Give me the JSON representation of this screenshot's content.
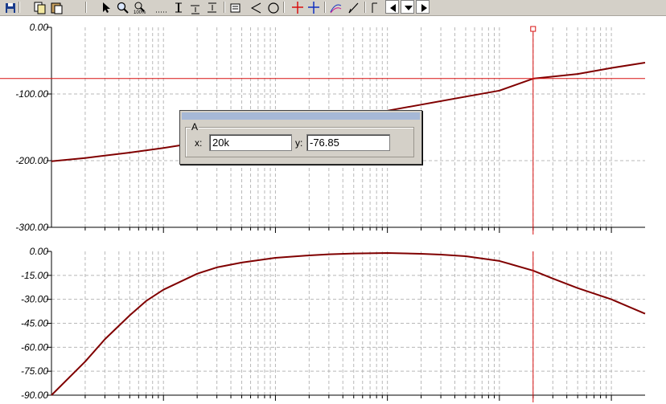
{
  "colors": {
    "curve": "#800000",
    "cursor": "#d81010",
    "grid": "#b8b8b8",
    "axis": "#000000",
    "toolbar_bg": "#d4d0c8"
  },
  "toolbar": {
    "icons": [
      "save-icon",
      "copy-icon",
      "paste-icon",
      "pointer-icon",
      "zoom-icon",
      "zoom-100-icon",
      "dotted-line-icon",
      "text-icon",
      "align-bottom-icon",
      "align-top-icon",
      "properties-icon",
      "angle-icon",
      "circle-icon",
      "cursor-red-icon",
      "cursor-blue-icon",
      "curve-select-icon",
      "pen-icon",
      "marker-icon",
      "arrow-left-icon",
      "dropdown-icon",
      "arrow-right-icon"
    ],
    "zoom_label": "100%"
  },
  "cursor_dialog": {
    "cursor_name": "A",
    "x_label": "x:",
    "x_value": "20k",
    "y_label": "y:",
    "y_value": "-76.85"
  },
  "chart_data": [
    {
      "type": "line",
      "x_scale": "log",
      "xlim": [
        1,
        200000
      ],
      "ylim": [
        -300,
        0
      ],
      "y_ticks": [
        "0.00",
        "-100.00",
        "-200.00",
        "-300.00"
      ],
      "y_tick_values": [
        0,
        -100,
        -200,
        -300
      ],
      "grid": true,
      "series": [
        {
          "x": [
            1,
            2,
            5,
            10,
            20,
            50,
            100,
            200,
            500,
            1000,
            2000,
            5000,
            10000,
            20000,
            50000,
            100000,
            200000
          ],
          "y": [
            -201,
            -196,
            -188,
            -181,
            -173,
            -162,
            -154,
            -145,
            -134,
            -125,
            -116,
            -104,
            -95,
            -77,
            -70,
            -61,
            -53
          ]
        }
      ],
      "cursor": {
        "x": 20000,
        "y": -76.85
      }
    },
    {
      "type": "line",
      "x_scale": "log",
      "xlim": [
        1,
        200000
      ],
      "ylim": [
        -90,
        0
      ],
      "y_ticks": [
        "0.00",
        "-15.00",
        "-30.00",
        "-45.00",
        "-60.00",
        "-75.00",
        "-90.00"
      ],
      "y_tick_values": [
        0,
        -15,
        -30,
        -45,
        -60,
        -75,
        -90
      ],
      "grid": true,
      "series": [
        {
          "x": [
            1,
            2,
            3,
            5,
            7,
            10,
            20,
            30,
            50,
            100,
            200,
            300,
            500,
            1000,
            2000,
            3000,
            5000,
            10000,
            20000,
            30000,
            50000,
            100000,
            200000
          ],
          "y": [
            -90,
            -69,
            -55,
            -40,
            -31,
            -24,
            -14,
            -10,
            -7,
            -4,
            -2.5,
            -1.8,
            -1.3,
            -1,
            -1.5,
            -2,
            -3,
            -6,
            -12,
            -17,
            -23,
            -30,
            -39
          ]
        }
      ],
      "cursor": {
        "x": 20000
      }
    }
  ]
}
